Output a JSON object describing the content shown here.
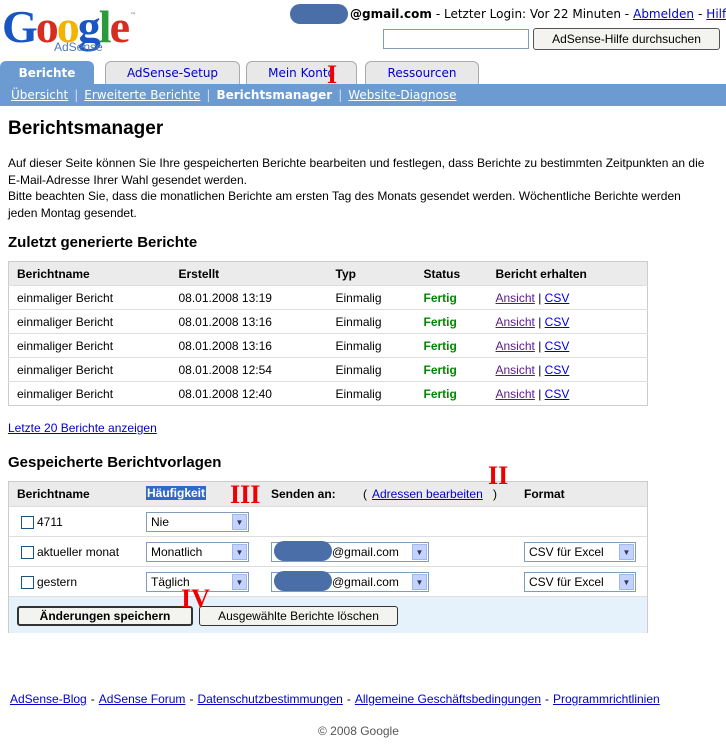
{
  "logo": {
    "word": "Google",
    "tm": "™",
    "sub": "AdSense"
  },
  "header": {
    "email": "@gmail.com",
    "login_text": "- Letzter Login: Vor 22 Minuten -",
    "logout": "Abmelden",
    "help": "Hilfe",
    "search_placeholder": "",
    "search_button": "AdSense-Hilfe durchsuchen"
  },
  "tabs": [
    "Berichte",
    "AdSense-Setup",
    "Mein Konto",
    "Ressourcen"
  ],
  "subnav": [
    "Übersicht",
    "Erweiterte Berichte",
    "Berichtsmanager",
    "Website-Diagnose"
  ],
  "markers": [
    "I",
    "II",
    "III",
    "IV"
  ],
  "page_title": "Berichtsmanager",
  "intro": [
    "Auf dieser Seite können Sie Ihre gespeicherten Berichte bearbeiten und festlegen, dass Berichte zu bestimmten Zeitpunkten an die E-Mail-Adresse Ihrer Wahl gesendet werden.",
    "Bitte beachten Sie, dass die monatlichen Berichte am ersten Tag des Monats gesendet werden. Wöchentliche Berichte werden jeden Montag gesendet."
  ],
  "recent": {
    "heading": "Zuletzt generierte Berichte",
    "columns": [
      "Berichtname",
      "Erstellt",
      "Typ",
      "Status",
      "Bericht erhalten"
    ],
    "rows": [
      {
        "name": "einmaliger Bericht",
        "created": "08.01.2008 13:19",
        "type": "Einmalig",
        "status": "Fertig"
      },
      {
        "name": "einmaliger Bericht",
        "created": "08.01.2008 13:16",
        "type": "Einmalig",
        "status": "Fertig"
      },
      {
        "name": "einmaliger Bericht",
        "created": "08.01.2008 13:16",
        "type": "Einmalig",
        "status": "Fertig"
      },
      {
        "name": "einmaliger Bericht",
        "created": "08.01.2008 12:54",
        "type": "Einmalig",
        "status": "Fertig"
      },
      {
        "name": "einmaliger Bericht",
        "created": "08.01.2008 12:40",
        "type": "Einmalig",
        "status": "Fertig"
      }
    ],
    "view_label": "Ansicht",
    "csv_label": "CSV",
    "last20": "Letzte 20 Berichte anzeigen"
  },
  "templates": {
    "heading": "Gespeicherte Berichtvorlagen",
    "col_name": "Berichtname",
    "col_freq": "Häufigkeit",
    "col_send": "Senden an:",
    "edit_addresses": "Adressen bearbeiten",
    "paren_open": "(",
    "paren_close": ")",
    "col_format": "Format",
    "rows": [
      {
        "name": "4711",
        "freq": "Nie",
        "email": "",
        "format": ""
      },
      {
        "name": "aktueller monat",
        "freq": "Monatlich",
        "email": "@gmail.com",
        "format": "CSV für Excel"
      },
      {
        "name": "gestern",
        "freq": "Täglich",
        "email": "@gmail.com",
        "format": "CSV für Excel"
      }
    ],
    "save_button": "Änderungen speichern",
    "delete_button": "Ausgewählte Berichte löschen"
  },
  "footer": {
    "links": [
      "AdSense-Blog",
      "AdSense Forum",
      "Datenschutzbestimmungen",
      "Allgemeine Geschäftsbedingungen",
      "Programmrichtlinien"
    ],
    "copyright": "© 2008 Google"
  },
  "colors": {
    "tab_active": "#6b9bd1",
    "status_ok": "#008800",
    "marker": "#ee0000",
    "footer_bg": "#e5f1fb"
  }
}
